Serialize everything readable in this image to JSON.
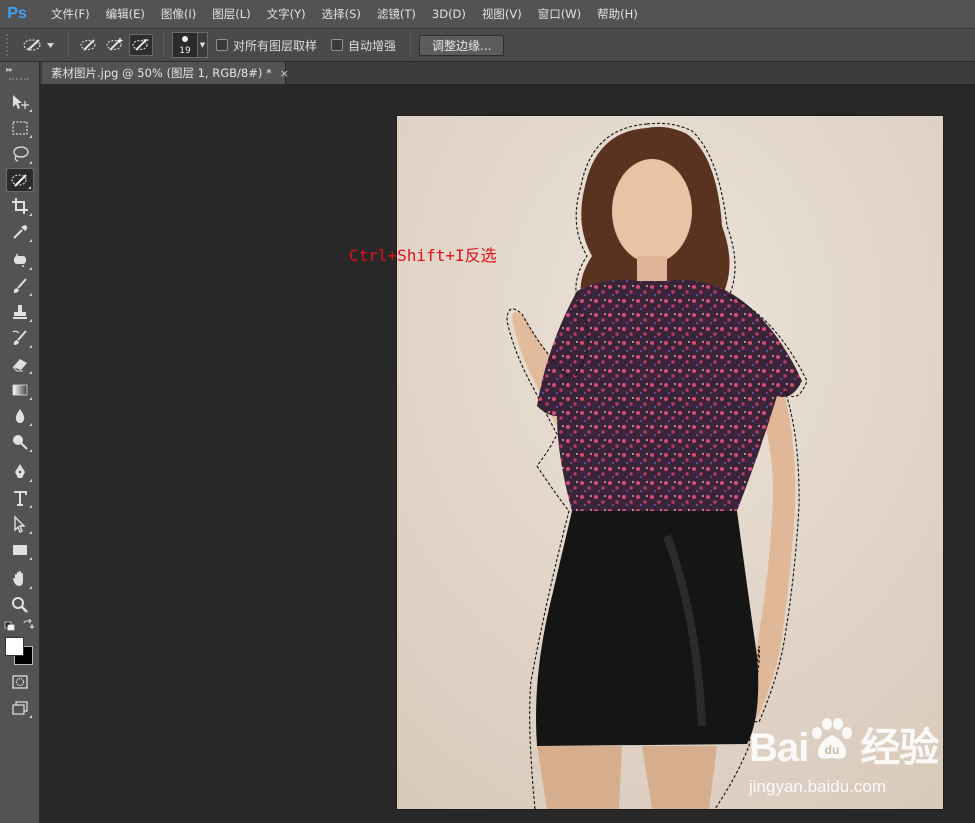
{
  "app": {
    "logo": "Ps"
  },
  "menu": [
    "文件(F)",
    "编辑(E)",
    "图像(I)",
    "图层(L)",
    "文字(Y)",
    "选择(S)",
    "滤镜(T)",
    "3D(D)",
    "视图(V)",
    "窗口(W)",
    "帮助(H)"
  ],
  "options": {
    "brush_size": "19",
    "sample_all_layers": "对所有图层取样",
    "auto_enhance": "自动增强",
    "refine_edge": "调整边缘..."
  },
  "document": {
    "tab_title": "素材图片.jpg @ 50% (图层 1, RGB/8#) *",
    "close_glyph": "×"
  },
  "annotation": "Ctrl+Shift+I反选",
  "watermark": {
    "brand_left": "Bai",
    "brand_right": "经验",
    "url": "jingyan.baidu.com"
  },
  "colors": {
    "accent_logo": "#3ea1f5",
    "annotation": "#e0101a",
    "foreground": "#ffffff",
    "background": "#000000"
  }
}
